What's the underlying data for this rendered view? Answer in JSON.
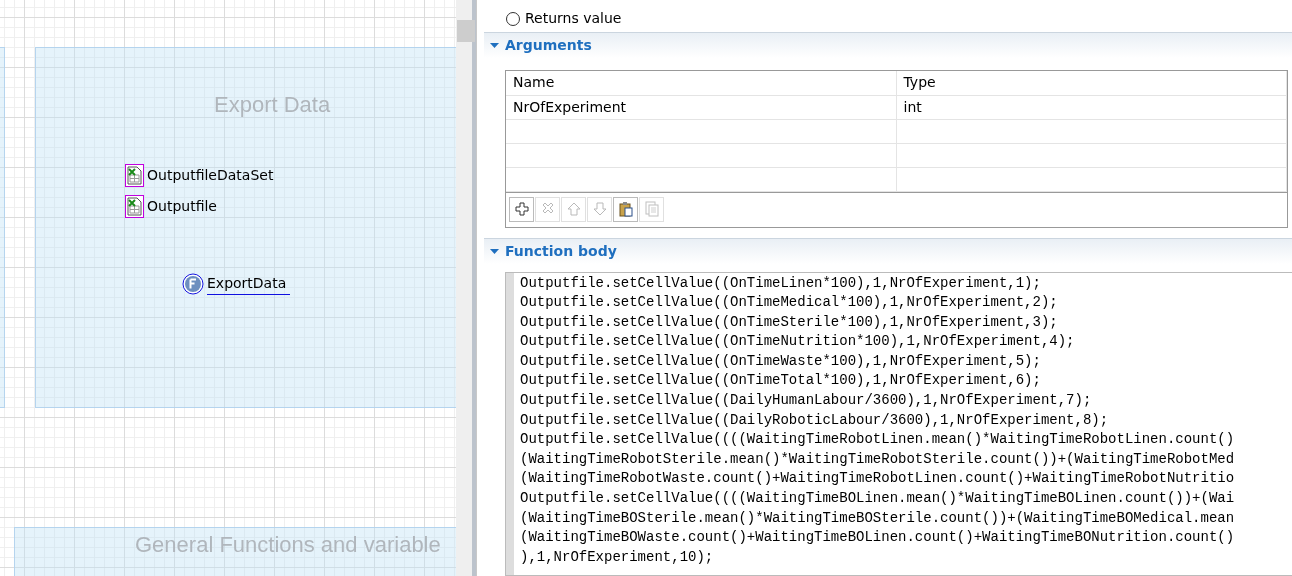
{
  "canvas": {
    "regions": [
      {
        "title": "Export Data",
        "kind": "main"
      },
      {
        "title": "General Functions and variable",
        "kind": "bottom"
      }
    ],
    "items": [
      {
        "kind": "excel",
        "label": "OutputfileDataSet",
        "selected": true
      },
      {
        "kind": "excel",
        "label": "Outputfile",
        "selected": true
      },
      {
        "kind": "function",
        "label": "ExportData",
        "selected": false
      }
    ]
  },
  "properties": {
    "returns_value": {
      "label": "Returns value",
      "selected": false
    },
    "arguments": {
      "title": "Arguments",
      "expanded": true,
      "columns": [
        "Name",
        "Type"
      ],
      "rows": [
        [
          "NrOfExperiment",
          "int"
        ]
      ],
      "toolbar": [
        {
          "kind": "add",
          "disabled": false
        },
        {
          "kind": "delete",
          "disabled": true
        },
        {
          "kind": "up",
          "disabled": true
        },
        {
          "kind": "down",
          "disabled": true
        },
        {
          "kind": "paste",
          "disabled": false
        },
        {
          "kind": "copy",
          "disabled": true
        }
      ]
    },
    "function_body": {
      "title": "Function body",
      "expanded": true,
      "lines": [
        "Outputfile.setCellValue((OnTimeLinen*100),1,NrOfExperiment,1);",
        "Outputfile.setCellValue((OnTimeMedical*100),1,NrOfExperiment,2);",
        "Outputfile.setCellValue((OnTimeSterile*100),1,NrOfExperiment,3);",
        "Outputfile.setCellValue((OnTimeNutrition*100),1,NrOfExperiment,4);",
        "Outputfile.setCellValue((OnTimeWaste*100),1,NrOfExperiment,5);",
        "Outputfile.setCellValue((OnTimeTotal*100),1,NrOfExperiment,6);",
        "Outputfile.setCellValue((DailyHumanLabour/3600),1,NrOfExperiment,7);",
        "Outputfile.setCellValue((DailyRoboticLabour/3600),1,NrOfExperiment,8);",
        "Outputfile.setCellValue((((WaitingTimeRobotLinen.mean()*WaitingTimeRobotLinen.count()",
        "(WaitingTimeRobotSterile.mean()*WaitingTimeRobotSterile.count())+(WaitingTimeRobotMed",
        "(WaitingTimeRobotWaste.count()+WaitingTimeRobotLinen.count()+WaitingTimeRobotNutritio",
        "Outputfile.setCellValue((((WaitingTimeBOLinen.mean()*WaitingTimeBOLinen.count())+(Wai",
        "(WaitingTimeBOSterile.mean()*WaitingTimeBOSterile.count())+(WaitingTimeBOMedical.mean",
        "(WaitingTimeBOWaste.count()+WaitingTimeBOLinen.count()+WaitingTimeBONutrition.count()",
        "),1,NrOfExperiment,10);"
      ]
    }
  }
}
